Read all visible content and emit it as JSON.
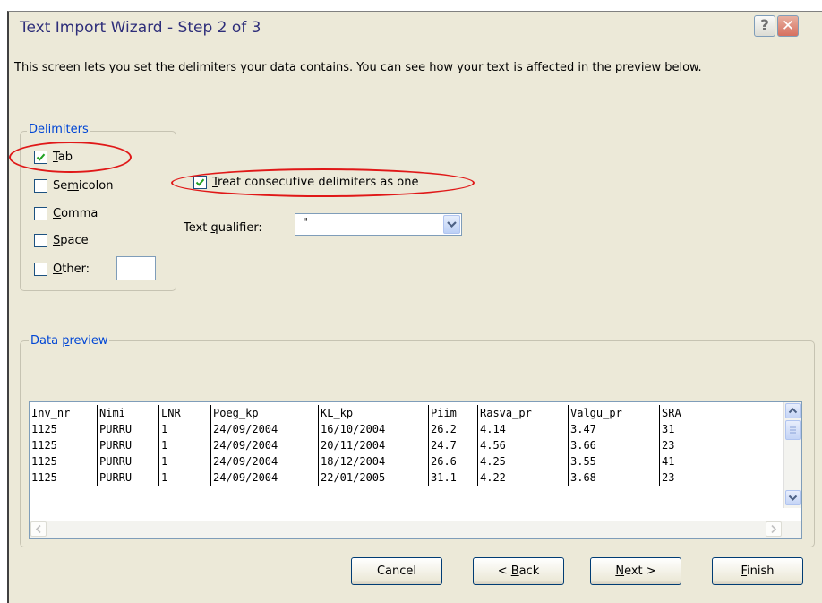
{
  "window": {
    "title": "Text Import Wizard - Step 2 of 3"
  },
  "intro": "This screen lets you set the delimiters your data contains.  You can see how your text is affected in the preview below.",
  "delimiters": {
    "legend": "Delimiters",
    "items": [
      {
        "pre": "",
        "key": "T",
        "post": "ab",
        "checked": true
      },
      {
        "pre": "Se",
        "key": "m",
        "post": "icolon",
        "checked": false
      },
      {
        "pre": "",
        "key": "C",
        "post": "omma",
        "checked": false
      },
      {
        "pre": "",
        "key": "S",
        "post": "pace",
        "checked": false
      },
      {
        "pre": "",
        "key": "O",
        "post": "ther:",
        "checked": false
      }
    ],
    "other_value": ""
  },
  "consecutive": {
    "pre": "",
    "key": "T",
    "post": "reat consecutive delimiters as one",
    "checked": true
  },
  "text_qualifier": {
    "pre": "Text ",
    "key": "q",
    "post": "ualifier:",
    "value": "\""
  },
  "preview": {
    "legend_pre": "Data ",
    "legend_key": "p",
    "legend_post": "review",
    "headers": [
      "Inv_nr",
      "Nimi",
      "LNR",
      "Poeg_kp",
      "KL_kp",
      "Piim",
      "Rasva_pr",
      "Valgu_pr",
      "SRA"
    ],
    "rows": [
      [
        "1125",
        "PURRU",
        "1",
        "24/09/2004",
        "16/10/2004",
        "26.2",
        "4.14",
        "3.47",
        "31"
      ],
      [
        "1125",
        "PURRU",
        "1",
        "24/09/2004",
        "20/11/2004",
        "24.7",
        "4.56",
        "3.66",
        "23"
      ],
      [
        "1125",
        "PURRU",
        "1",
        "24/09/2004",
        "18/12/2004",
        "26.6",
        "4.25",
        "3.55",
        "41"
      ],
      [
        "1125",
        "PURRU",
        "1",
        "24/09/2004",
        "22/01/2005",
        "31.1",
        "4.22",
        "3.68",
        "23"
      ]
    ]
  },
  "buttons": {
    "cancel": "Cancel",
    "back_pre": "< ",
    "back_key": "B",
    "back_post": "ack",
    "next_pre": "",
    "next_key": "N",
    "next_post": "ext >",
    "finish_pre": "",
    "finish_key": "F",
    "finish_post": "inish"
  },
  "colors": {
    "annotation": "#e01818",
    "legend_text": "#0046d5",
    "dialog_bg": "#ece9d8"
  }
}
